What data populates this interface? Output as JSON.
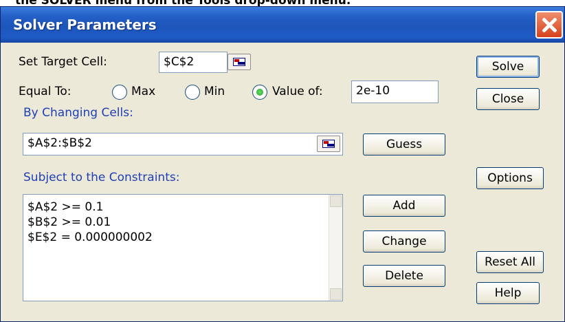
{
  "caption": "the SOLVER menu from the Tools drop-down menu.",
  "window": {
    "title": "Solver Parameters"
  },
  "target": {
    "label": "Set Target Cell:",
    "value": "$C$2"
  },
  "equal_to": {
    "label": "Equal To:",
    "options": [
      {
        "label": "Max",
        "selected": false
      },
      {
        "label": "Min",
        "selected": false
      },
      {
        "label": "Value of:",
        "selected": true
      }
    ],
    "value_of": "2e-10"
  },
  "changing": {
    "label": "By Changing Cells:",
    "value": "$A$2:$B$2"
  },
  "constraints": {
    "label": "Subject to the Constraints:",
    "items": [
      "$A$2 >= 0.1",
      "$B$2 >= 0.01",
      "$E$2 = 0.000000002"
    ]
  },
  "buttons": {
    "solve": "Solve",
    "close": "Close",
    "guess": "Guess",
    "options": "Options",
    "add": "Add",
    "change": "Change",
    "delete": "Delete",
    "reset_all": "Reset All",
    "help": "Help"
  },
  "colors": {
    "titlebar": "#1d55b9",
    "label_blue": "#1f3fb4",
    "dialog_bg": "#ece9d8"
  }
}
